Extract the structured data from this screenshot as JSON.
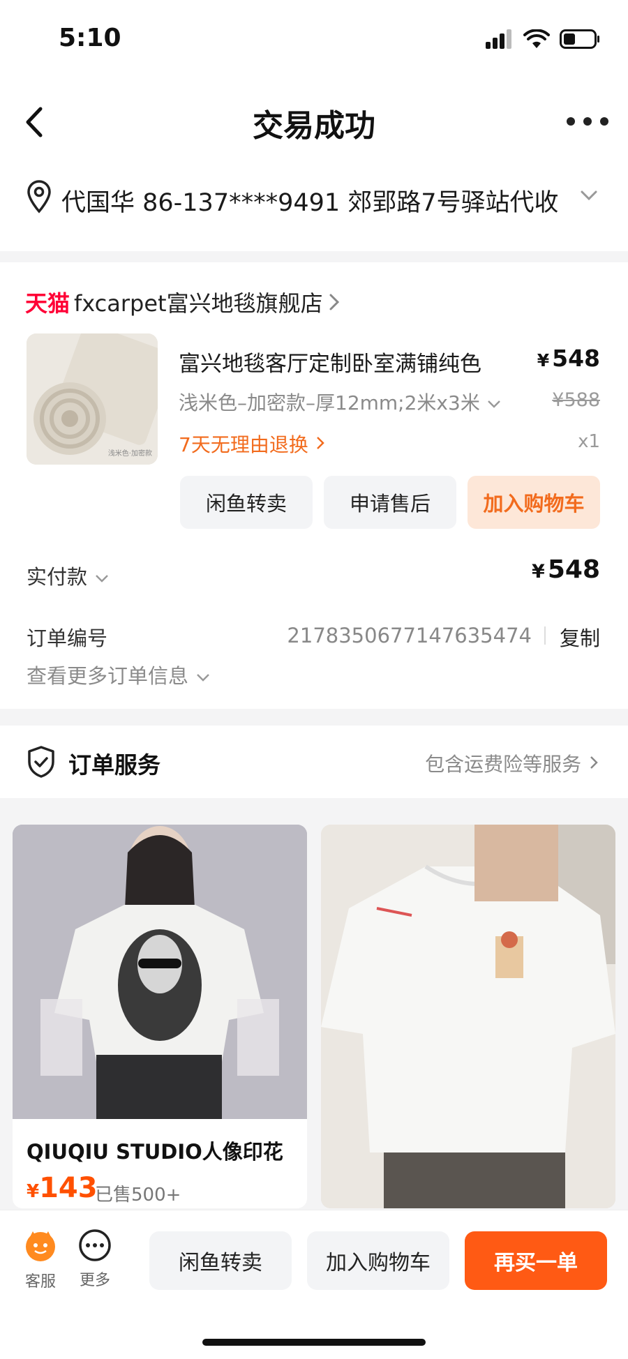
{
  "status_bar": {
    "time": "5:10"
  },
  "header": {
    "title": "交易成功"
  },
  "address": {
    "text": "代国华  86-137****9491  郊郢路7号驿站代收"
  },
  "store": {
    "badge": "天猫",
    "name": "fxcarpet富兴地毯旗舰店"
  },
  "product": {
    "name": "富兴地毯客厅定制卧室满铺纯色",
    "price_symbol": "¥",
    "price": "548",
    "spec": "浅米色–加密款–厚12mm;2米x3米",
    "original_price": "¥588",
    "return_tag": "7天无理由退换",
    "quantity": "x1",
    "thumb_caption": "浅米色·加密款",
    "actions": [
      "闲鱼转卖",
      "申请售后",
      "加入购物车"
    ]
  },
  "payment": {
    "label": "实付款",
    "symbol": "¥",
    "amount": "548"
  },
  "order": {
    "label": "订单编号",
    "number": "2178350677147635474",
    "copy_label": "复制",
    "more_info": "查看更多订单信息"
  },
  "service": {
    "title": "订单服务",
    "link": "包含运费险等服务"
  },
  "recommendations": [
    {
      "title": "QIUQIU STUDIO人像印花",
      "price_symbol": "¥",
      "price": "143",
      "sold": "已售500+"
    }
  ],
  "bottom_bar": {
    "kefu_label": "客服",
    "more_label": "更多",
    "buttons": [
      "闲鱼转卖",
      "加入购物车",
      "再买一单"
    ]
  },
  "colors": {
    "accent": "#ff5a14",
    "tmall": "#ff0036",
    "orange_text": "#f26b1d"
  }
}
